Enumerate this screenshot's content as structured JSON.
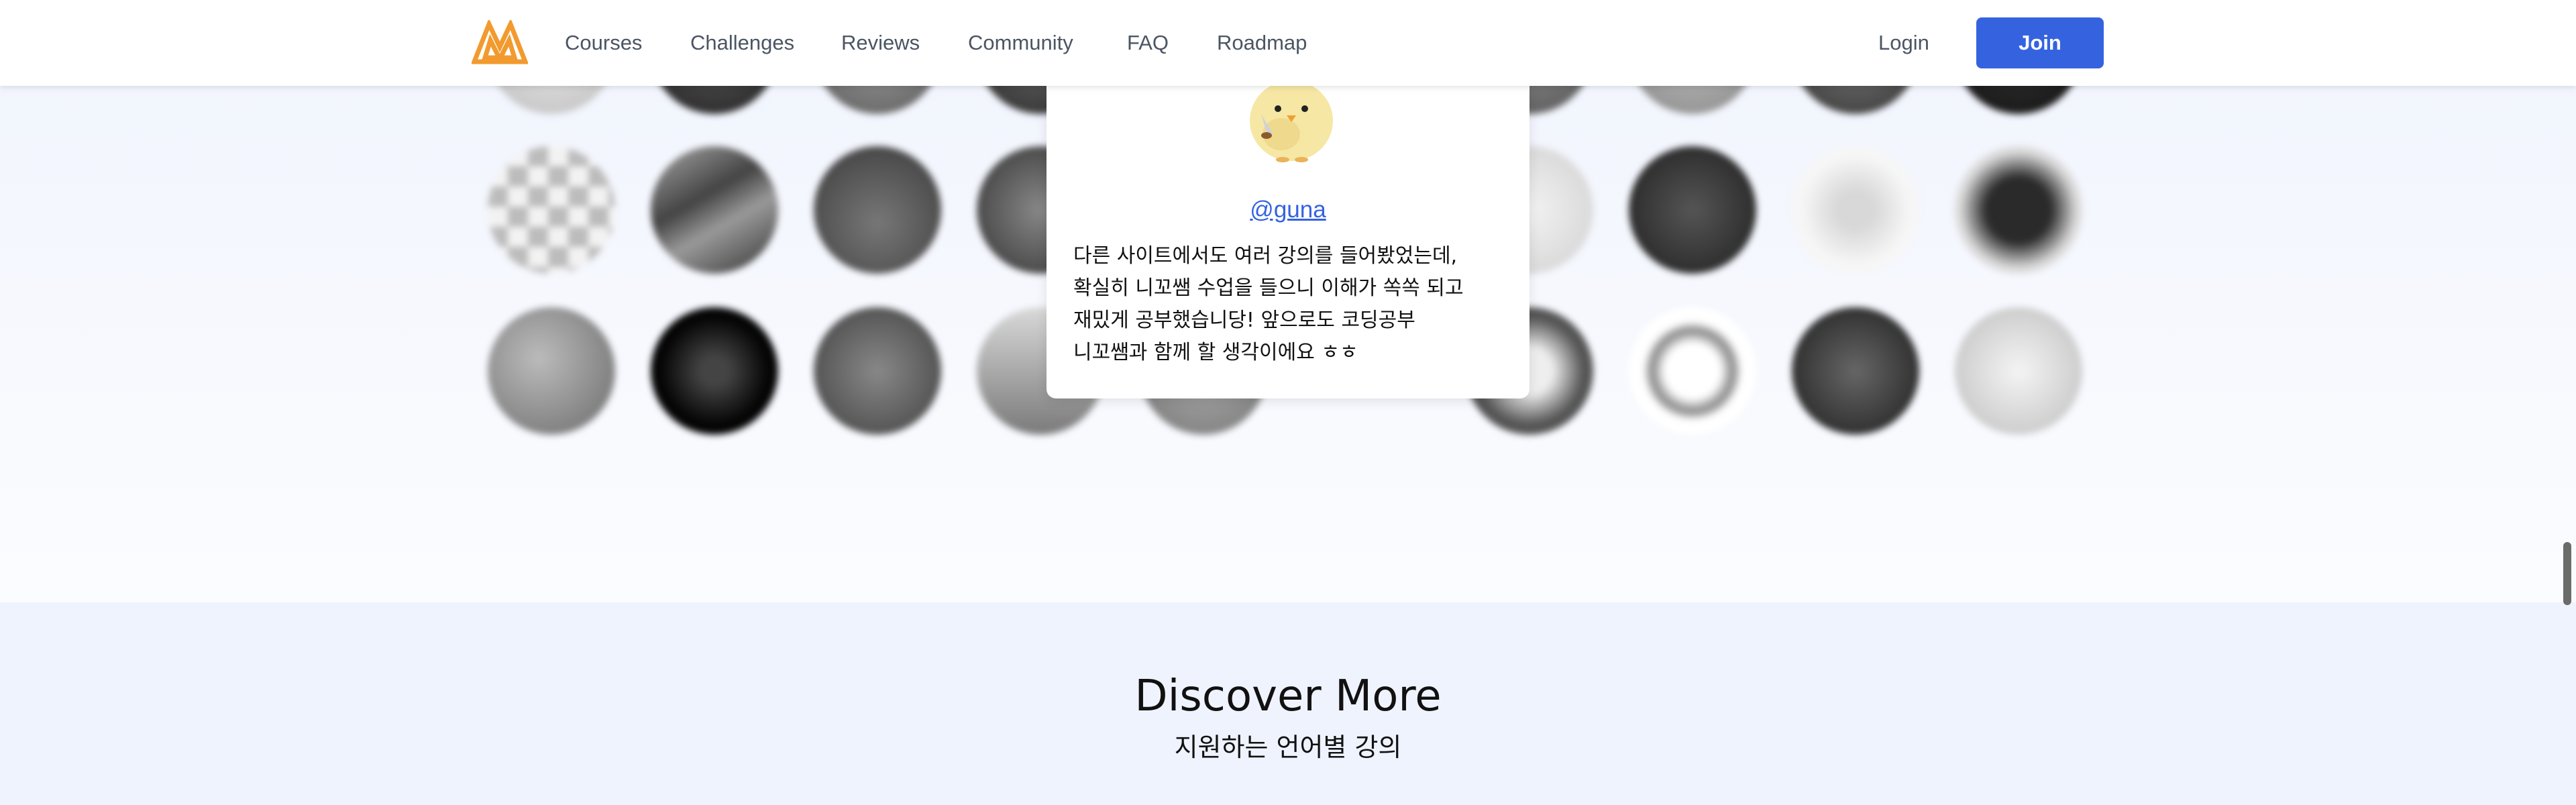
{
  "nav": {
    "links": [
      {
        "label": "Courses"
      },
      {
        "label": "Challenges"
      },
      {
        "label": "Reviews"
      },
      {
        "label": "Community"
      },
      {
        "label": "FAQ"
      },
      {
        "label": "Roadmap"
      }
    ],
    "login_label": "Login",
    "join_label": "Join",
    "brand_color": "#f29a2e",
    "accent_color": "#3563e0"
  },
  "review": {
    "handle": "@guna",
    "text": "다른 사이트에서도 여러 강의를 들어봤었는데,\n확실히 니꼬쌤 수업을 들으니 이해가 쏙쏙 되고\n재밌게 공부했습니당! 앞으로도 코딩공부\n니꼬쌤과 함께 할 생각이에요 ㅎㅎ"
  },
  "discover": {
    "title": "Discover More",
    "subtitle": "지원하는 언어별 강의"
  }
}
